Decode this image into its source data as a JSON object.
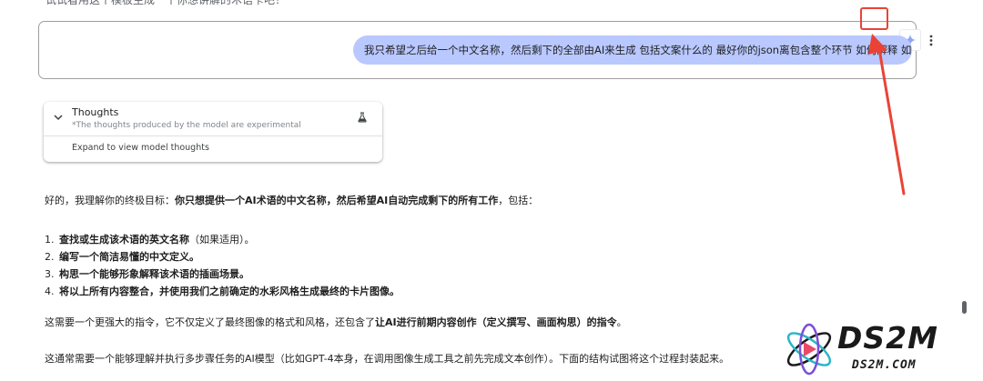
{
  "top_partial_text": "试试看用这个模板生成一个你想讲解的术语卡吧！",
  "message": {
    "text": "我只希望之后给一个中文名称，然后剩下的全部由AI来生成 包括文案什么的 最好你的json离包含整个环节 如何解释 如何说明",
    "tools": [
      "edit-icon",
      "rerun-sparkle-icon",
      "more-vert-icon"
    ]
  },
  "thoughts": {
    "title": "Thoughts",
    "subtitle": "*The thoughts produced by the model are experimental",
    "expand": "Expand to view model thoughts",
    "icon": "flask-icon"
  },
  "response": {
    "intro_prefix": "好的，我理解你的终极目标：",
    "intro_bold": "你只想提供一个AI术语的中文名称，然后希望AI自动完成剩下的所有工作",
    "intro_suffix": "，包括：",
    "steps": [
      {
        "num": "1.",
        "bold": "查找或生成该术语的英文名称",
        "normal": "（如果适用）。"
      },
      {
        "num": "2.",
        "bold": "编写一个简洁易懂的中文定义。",
        "normal": ""
      },
      {
        "num": "3.",
        "bold": "构思一个能够形象解释该术语的插画场景。",
        "normal": ""
      },
      {
        "num": "4.",
        "bold": "将以上所有内容整合，并使用我们之前确定的水彩风格生成最终的卡片图像。",
        "normal": ""
      }
    ],
    "para2_prefix": "这需要一个更强大的指令，它不仅定义了最终图像的格式和风格，还包含了",
    "para2_bold": "让AI进行前期内容创作（定义撰写、画面构思）的指令",
    "para2_suffix": "。",
    "para3": "这通常需要一个能够理解并执行多步骤任务的AI模型（比如GPT-4本身，在调用图像生成工具之前先完成文本创作）。下面的结构试图将这个过程封装起来。"
  },
  "watermark": {
    "brand": "DS2M",
    "domain": "DS2M.COM"
  },
  "colors": {
    "bubble": "#b9c8ff",
    "highlight": "#ea4335",
    "sparkle": "#8fa6f5"
  }
}
